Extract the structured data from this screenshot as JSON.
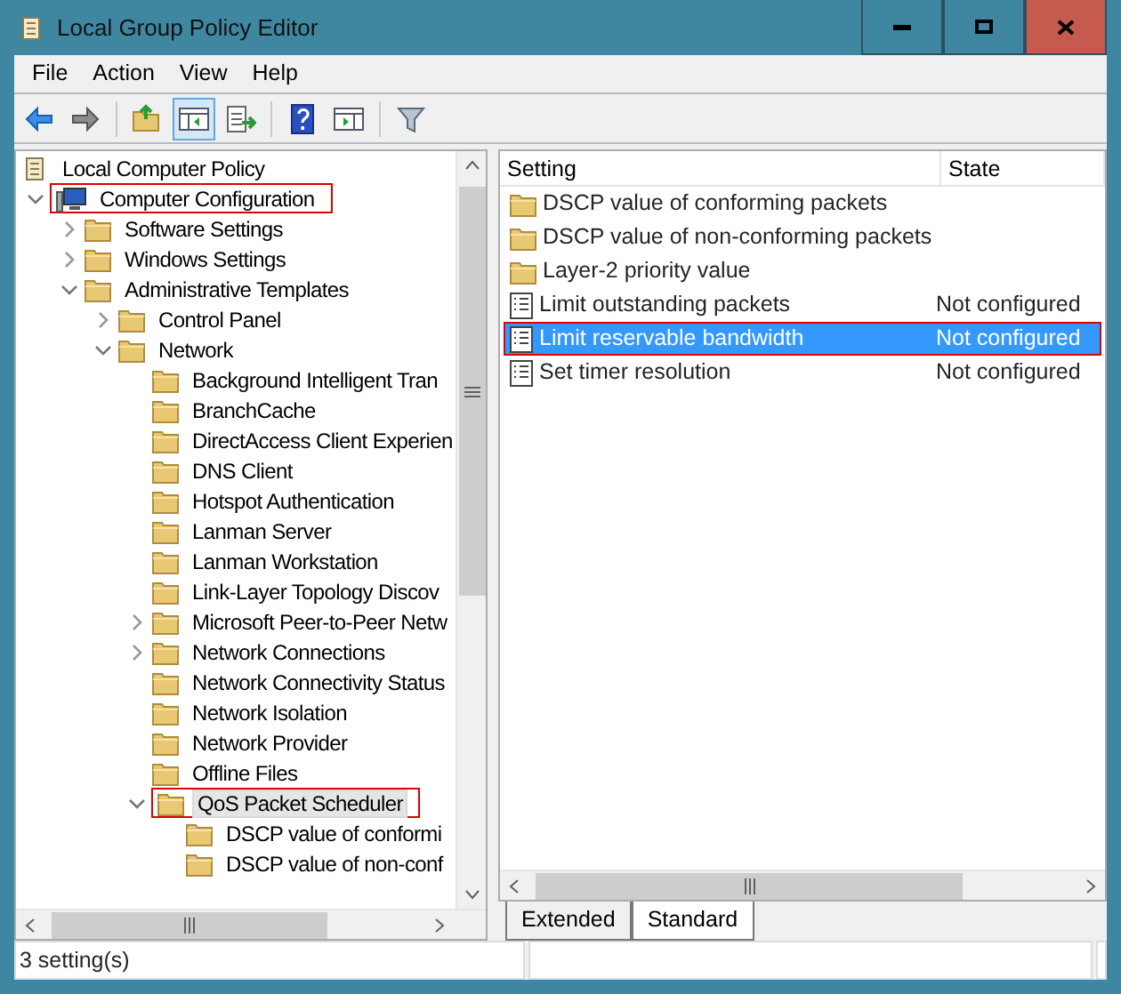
{
  "window": {
    "title": "Local Group Policy Editor"
  },
  "menu": [
    "File",
    "Action",
    "View",
    "Help"
  ],
  "toolbar": [
    {
      "kind": "back",
      "pressed": false
    },
    {
      "kind": "forward",
      "pressed": false
    },
    {
      "kind": "up",
      "pressed": false
    },
    {
      "kind": "tree-toggle",
      "pressed": true
    },
    {
      "kind": "export",
      "pressed": false
    },
    {
      "kind": "help",
      "pressed": false
    },
    {
      "kind": "pane-toggle",
      "pressed": false
    },
    {
      "kind": "filter",
      "pressed": false
    }
  ],
  "tree": [
    {
      "label": "Local Computer Policy",
      "kind": "scroll",
      "children": [
        {
          "label": "Computer Configuration",
          "kind": "computer",
          "expanded": true,
          "highlighted": true,
          "children": [
            {
              "label": "Software Settings",
              "kind": "folder",
              "expanded": false
            },
            {
              "label": "Windows Settings",
              "kind": "folder",
              "expanded": false
            },
            {
              "label": "Administrative Templates",
              "kind": "folder",
              "expanded": true,
              "children": [
                {
                  "label": "Control Panel",
                  "kind": "folder",
                  "expanded": false
                },
                {
                  "label": "Network",
                  "kind": "folder",
                  "expanded": true,
                  "children": [
                    {
                      "label": "Background Intelligent Tran",
                      "kind": "folder"
                    },
                    {
                      "label": "BranchCache",
                      "kind": "folder"
                    },
                    {
                      "label": "DirectAccess Client Experien",
                      "kind": "folder"
                    },
                    {
                      "label": "DNS Client",
                      "kind": "folder"
                    },
                    {
                      "label": "Hotspot Authentication",
                      "kind": "folder"
                    },
                    {
                      "label": "Lanman Server",
                      "kind": "folder"
                    },
                    {
                      "label": "Lanman Workstation",
                      "kind": "folder"
                    },
                    {
                      "label": "Link-Layer Topology Discov",
                      "kind": "folder"
                    },
                    {
                      "label": "Microsoft Peer-to-Peer Netw",
                      "kind": "folder",
                      "expanded": false
                    },
                    {
                      "label": "Network Connections",
                      "kind": "folder",
                      "expanded": false
                    },
                    {
                      "label": "Network Connectivity Status",
                      "kind": "folder"
                    },
                    {
                      "label": "Network Isolation",
                      "kind": "folder"
                    },
                    {
                      "label": "Network Provider",
                      "kind": "folder"
                    },
                    {
                      "label": "Offline Files",
                      "kind": "folder"
                    },
                    {
                      "label": "QoS Packet Scheduler",
                      "kind": "folder",
                      "expanded": true,
                      "selected": true,
                      "highlighted": true,
                      "children": [
                        {
                          "label": "DSCP value of conformi",
                          "kind": "folder"
                        },
                        {
                          "label": "DSCP value of non-conf",
                          "kind": "folder"
                        }
                      ]
                    }
                  ]
                }
              ]
            }
          ]
        }
      ]
    }
  ],
  "list": {
    "columns": [
      "Setting",
      "State"
    ],
    "rows": [
      {
        "kind": "folder",
        "setting": "DSCP value of conforming packets",
        "selected": false,
        "highlighted": false
      },
      {
        "kind": "folder",
        "setting": "DSCP value of non-conforming packets",
        "selected": false,
        "highlighted": false
      },
      {
        "kind": "folder",
        "setting": "Layer-2 priority value",
        "selected": false,
        "highlighted": false
      },
      {
        "kind": "setting",
        "setting": "Limit outstanding packets",
        "state": "Not configured",
        "selected": false,
        "highlighted": false
      },
      {
        "kind": "setting",
        "setting": "Limit reservable bandwidth",
        "state": "Not configured",
        "selected": true,
        "highlighted": true
      },
      {
        "kind": "setting",
        "setting": "Set timer resolution",
        "state": "Not configured",
        "selected": false,
        "highlighted": false
      }
    ]
  },
  "tabs": [
    {
      "label": "Extended",
      "selected": false
    },
    {
      "label": "Standard",
      "selected": true
    }
  ],
  "status_bar": {
    "text": "3 setting(s)"
  }
}
